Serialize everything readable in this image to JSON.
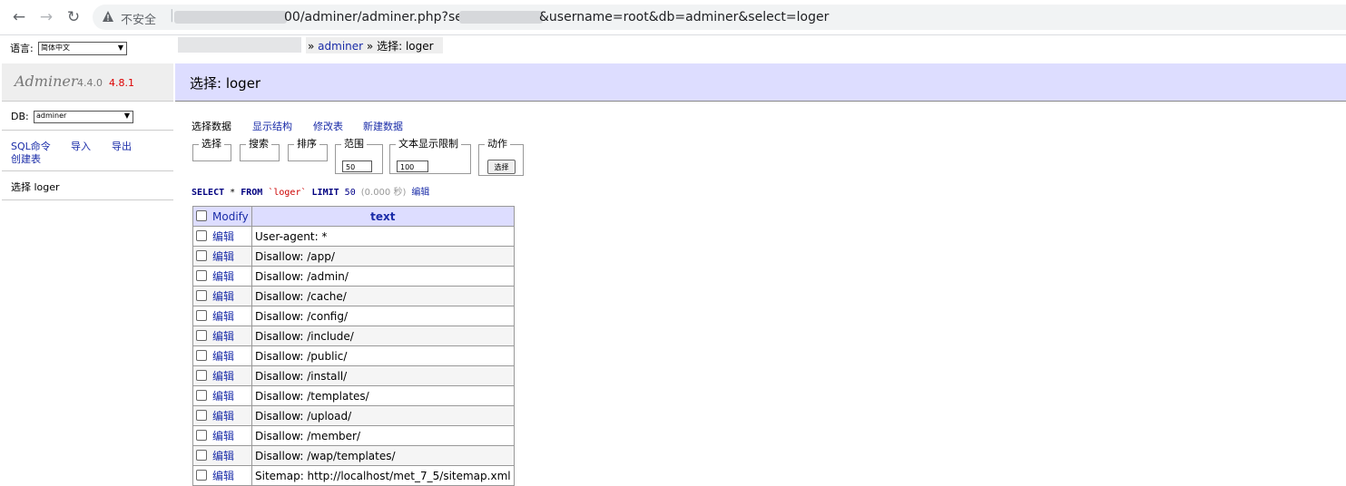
{
  "browser": {
    "insecure_label": "不安全",
    "url_part1": "00/adminer/adminer.php?server=",
    "url_part2": "&username=root&db=adminer&select=loger"
  },
  "sidebar": {
    "language_label": "语言:",
    "language_value": "简体中文",
    "brand_name": "Adminer",
    "version": "4.4.0",
    "new_version": "4.8.1",
    "db_label": "DB:",
    "db_value": "adminer",
    "links": [
      "SQL命令",
      "导入",
      "导出",
      "创建表"
    ],
    "table_link": "选择 loger"
  },
  "breadcrumb": {
    "sep1": "»",
    "db": "adminer",
    "sep2": "»",
    "current": "选择: loger"
  },
  "header": {
    "title": "选择: loger"
  },
  "tabs": [
    "选择数据",
    "显示结构",
    "修改表",
    "新建数据"
  ],
  "form": {
    "select_legend": "选择",
    "search_legend": "搜索",
    "sort_legend": "排序",
    "limit_legend": "范围",
    "limit_value": "50",
    "text_length_legend": "文本显示限制",
    "text_length_value": "100",
    "action_legend": "动作",
    "action_button": "选择"
  },
  "query": {
    "select": "SELECT",
    "star": "*",
    "from": "FROM",
    "table": "`loger`",
    "limit": "LIMIT",
    "limit_num": "50",
    "time": "(0.000 秒)",
    "edit": "编辑"
  },
  "grid": {
    "modify_header": "Modify",
    "text_header": "text",
    "edit_label": "编辑",
    "rows": [
      "User-agent: *",
      "Disallow: /app/",
      "Disallow: /admin/",
      "Disallow: /cache/",
      "Disallow: /config/",
      "Disallow: /include/",
      "Disallow: /public/",
      "Disallow: /install/",
      "Disallow: /templates/",
      "Disallow: /upload/",
      "Disallow: /member/",
      "Disallow: /wap/templates/",
      "Sitemap: http://localhost/met_7_5/sitemap.xml"
    ]
  },
  "colors": {
    "link": "#1a2ca8",
    "header_bg": "#ddddff",
    "new_version": "#dd0000"
  }
}
